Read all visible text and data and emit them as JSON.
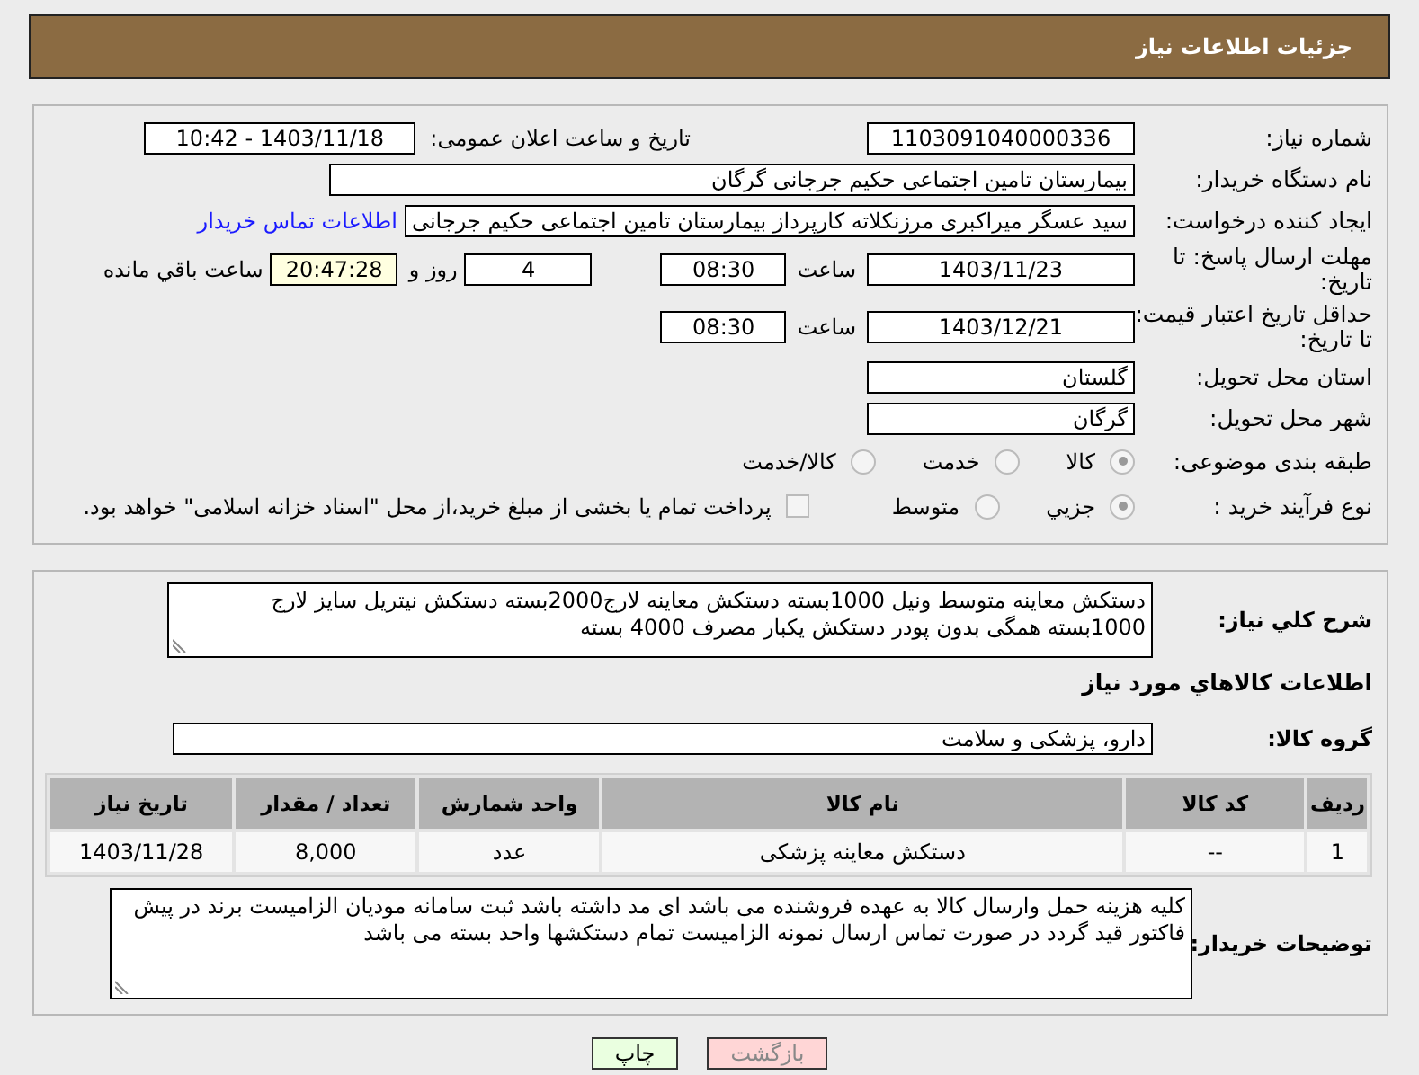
{
  "header": {
    "title": "جزئیات اطلاعات نیاز"
  },
  "need_number": {
    "label": "شماره نیاز:",
    "value": "1103091040000336"
  },
  "announce": {
    "label": "تاریخ و ساعت اعلان عمومی:",
    "value": "1403/11/18 - 10:42"
  },
  "buyer_org": {
    "label": "نام دستگاه خریدار:",
    "value": "بیمارستان تامین اجتماعی حکیم جرجانی گرگان"
  },
  "requester": {
    "label": "ایجاد کننده درخواست:",
    "value": "سید عسگر میراکبری مرزنکلاته کارپرداز بیمارستان تامین اجتماعی حکیم جرجانی",
    "link": "اطلاعات تماس خریدار"
  },
  "reply_deadline": {
    "label": "مهلت ارسال پاسخ: تا تاریخ:",
    "date": "1403/11/23",
    "time_label": "ساعت",
    "time": "08:30",
    "days": "4",
    "days_label": "روز و",
    "remaining": "20:47:28",
    "remaining_label": "ساعت باقي مانده"
  },
  "price_validity": {
    "label": "حداقل تاریخ اعتبار قیمت: تا تاریخ:",
    "date": "1403/12/21",
    "time_label": "ساعت",
    "time": "08:30"
  },
  "province": {
    "label": "استان محل تحویل:",
    "value": "گلستان"
  },
  "city": {
    "label": "شهر محل تحویل:",
    "value": "گرگان"
  },
  "category": {
    "label": "طبقه بندی موضوعی:",
    "options": [
      {
        "label": "کالا",
        "selected": true
      },
      {
        "label": "خدمت",
        "selected": false
      },
      {
        "label": "کالا/خدمت",
        "selected": false
      }
    ]
  },
  "purchase_type": {
    "label": "نوع فرآیند خرید :",
    "options": [
      {
        "label": "جزیي",
        "selected": true
      },
      {
        "label": "متوسط",
        "selected": false
      }
    ],
    "treasury": {
      "label": "پرداخت تمام یا بخشی از مبلغ خرید،از محل \"اسناد خزانه اسلامی\" خواهد بود.",
      "checked": false
    }
  },
  "description": {
    "label": "شرح کلي نیاز:",
    "text": "دستکش معاینه متوسط ونیل 1000بسته دستکش معاینه لارج2000بسته دستکش نیتریل سایز لارج 1000بسته همگی بدون پودر دستکش یکبار مصرف 4000 بسته"
  },
  "goods_heading": "اطلاعات کالاهاي مورد نیاز",
  "goods_group": {
    "label": "گروه کالا:",
    "value": "دارو، پزشکی و سلامت"
  },
  "table": {
    "columns": [
      "ردیف",
      "کد کالا",
      "نام کالا",
      "واحد شمارش",
      "تعداد / مقدار",
      "تاریخ نیاز"
    ],
    "rows": [
      [
        "1",
        "--",
        "دستکش معاینه پزشکی",
        "عدد",
        "8,000",
        "1403/11/28"
      ]
    ]
  },
  "buyer_notes": {
    "label": "توضیحات خریدار:",
    "text": "کلیه هزینه حمل وارسال کالا به عهده فروشنده می باشد ای مد داشته باشد ثبت سامانه مودیان الزامیست برند در پیش فاکتور قید گردد در صورت تماس ارسال نمونه الزامیست تمام دستکشها واحد بسته می باشد"
  },
  "buttons": [
    {
      "label": "بازگشت",
      "kind": "back"
    },
    {
      "label": "چاپ",
      "kind": "print"
    }
  ]
}
